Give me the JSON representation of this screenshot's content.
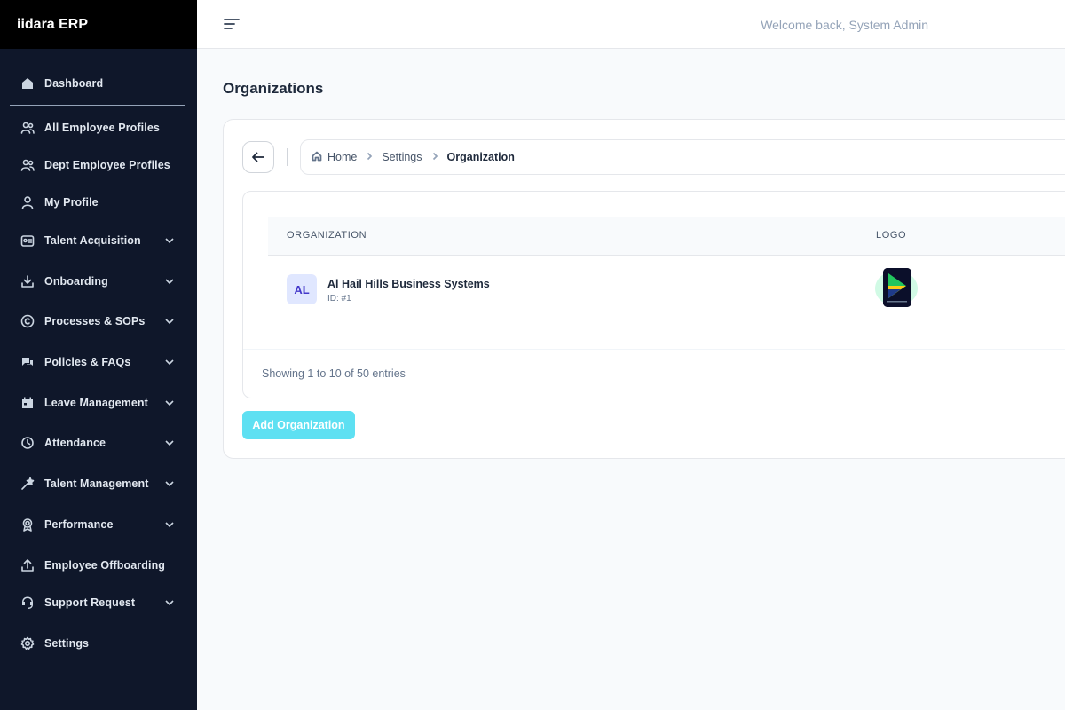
{
  "app": {
    "brand": "iidara ERP"
  },
  "topbar": {
    "welcome": "Welcome back, System Admin"
  },
  "sidebar": {
    "items": [
      {
        "label": "Dashboard",
        "icon": "dashboard-icon",
        "expandable": false
      },
      {
        "label": "All Employee Profiles",
        "icon": "users-icon",
        "expandable": false
      },
      {
        "label": "Dept Employee Profiles",
        "icon": "users-icon",
        "expandable": false
      },
      {
        "label": "My Profile",
        "icon": "user-icon",
        "expandable": false
      },
      {
        "label": "Talent Acquisition",
        "icon": "id-card-icon",
        "expandable": true
      },
      {
        "label": "Onboarding",
        "icon": "download-tray-icon",
        "expandable": true
      },
      {
        "label": "Processes & SOPs",
        "icon": "copyright-icon",
        "expandable": true
      },
      {
        "label": "Policies & FAQs",
        "icon": "chat-icon",
        "expandable": true
      },
      {
        "label": "Leave Management",
        "icon": "calendar-icon",
        "expandable": true
      },
      {
        "label": "Attendance",
        "icon": "clock-icon",
        "expandable": true
      },
      {
        "label": "Talent Management",
        "icon": "star-wand-icon",
        "expandable": true
      },
      {
        "label": "Performance",
        "icon": "award-icon",
        "expandable": true
      },
      {
        "label": "Employee Offboarding",
        "icon": "upload-tray-icon",
        "expandable": false
      },
      {
        "label": "Support Request",
        "icon": "headset-icon",
        "expandable": true
      },
      {
        "label": "Settings",
        "icon": "gear-icon",
        "expandable": false
      }
    ]
  },
  "page": {
    "title": "Organizations"
  },
  "breadcrumb": {
    "home": "Home",
    "settings": "Settings",
    "current": "Organization"
  },
  "table": {
    "columns": [
      "ORGANIZATION",
      "LOGO"
    ],
    "rows": [
      {
        "initials": "AL",
        "name": "Al Hail Hills Business Systems",
        "id": "ID: #1"
      }
    ],
    "footer": "Showing 1 to 10 of 50 entries"
  },
  "actions": {
    "add_label": "Add Organization"
  },
  "colors": {
    "sidebar_bg": "#0f172a",
    "brand_bg": "#000000",
    "accent": "#5ee0f2",
    "avatar_bg": "#e0e7ff",
    "avatar_text": "#4338ca"
  }
}
